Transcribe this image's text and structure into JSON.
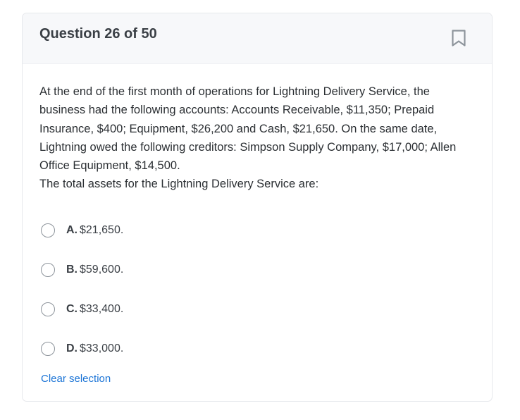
{
  "header": {
    "title": "Question 26 of 50",
    "bookmark_icon": "bookmark-icon"
  },
  "question": {
    "text": "At the end of the first month of operations for Lightning Delivery Service, the business had the following accounts: Accounts Receivable, $11,350; Prepaid Insurance, $400; Equipment, $26,200 and Cash, $21,650. On the same date, Lightning owed the following creditors: Simpson Supply Company, $17,000; Allen Office Equipment, $14,500.\nThe total assets for the Lightning Delivery Service are:"
  },
  "options": [
    {
      "letter": "A.",
      "text": "$21,650."
    },
    {
      "letter": "B.",
      "text": "$59,600."
    },
    {
      "letter": "C.",
      "text": "$33,400."
    },
    {
      "letter": "D.",
      "text": "$33,000."
    }
  ],
  "clear_label": "Clear selection",
  "colors": {
    "link": "#1b74d6",
    "header_bg": "#f7f8fa",
    "border": "#e6e8ec"
  }
}
